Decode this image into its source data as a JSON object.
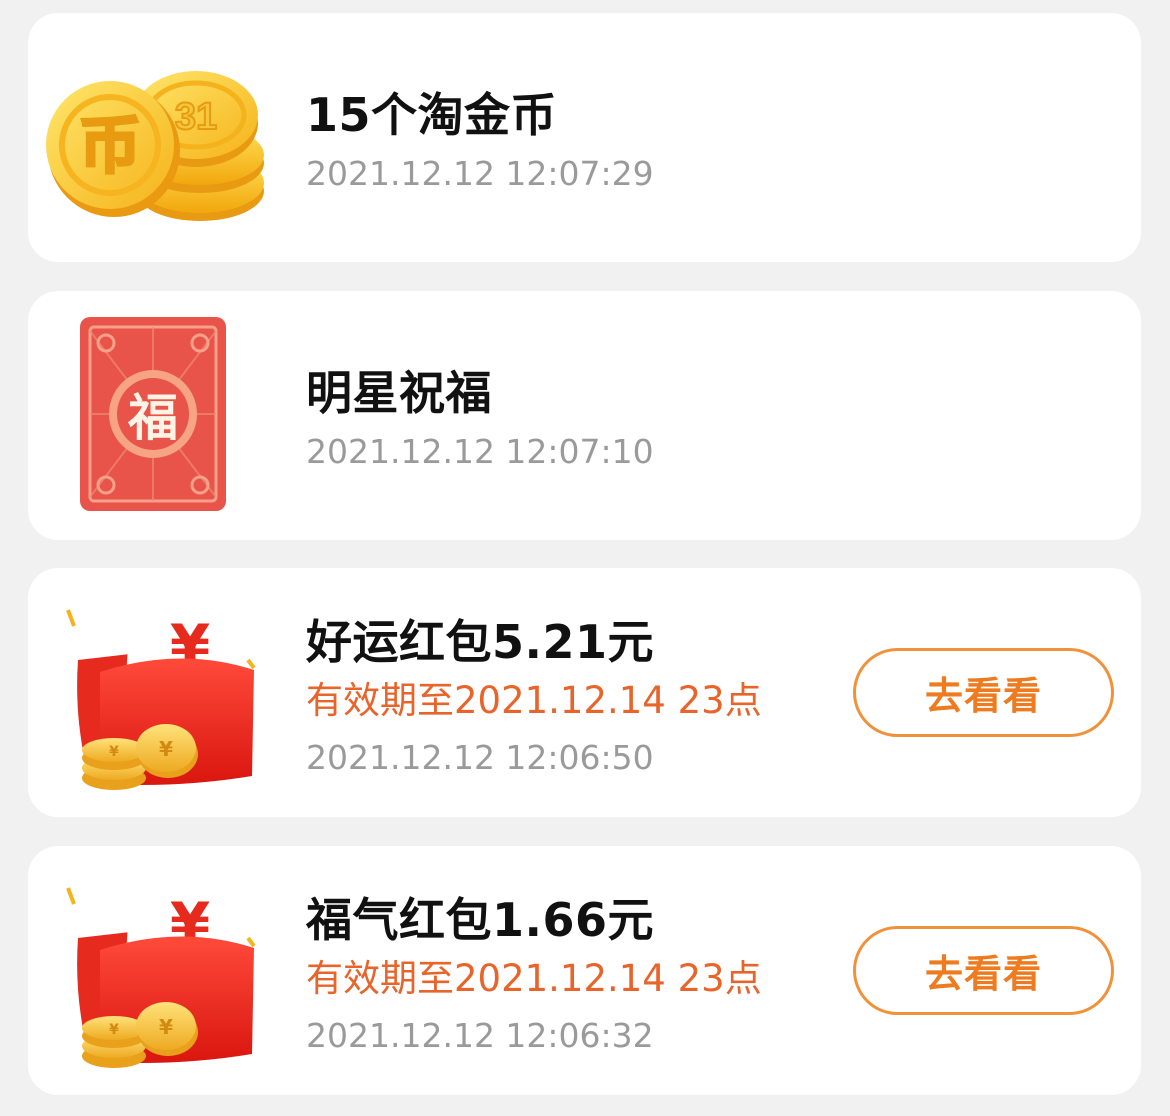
{
  "records": [
    {
      "icon": "gold-coins-icon",
      "title": "15个淘金币",
      "time": "2021.12.12 12:07:29"
    },
    {
      "icon": "blessing-card-icon",
      "title": "明星祝福",
      "time": "2021.12.12 12:07:10",
      "icon_text": "福"
    },
    {
      "icon": "red-envelope-icon",
      "title": "好运红包5.21元",
      "validity": "有效期至2021.12.14 23点",
      "time": "2021.12.12 12:06:50",
      "button_label": "去看看",
      "icon_text": "¥"
    },
    {
      "icon": "red-envelope-icon",
      "title": "福气红包1.66元",
      "validity": "有效期至2021.12.14 23点",
      "time": "2021.12.12 12:06:32",
      "button_label": "去看看",
      "icon_text": "¥"
    }
  ],
  "colors": {
    "background": "#f1f1f1",
    "card": "#ffffff",
    "validity_text": "#e8642a",
    "button_border": "#f0923a",
    "button_text": "#ee7b1f",
    "timestamp": "#9a9a9a"
  }
}
